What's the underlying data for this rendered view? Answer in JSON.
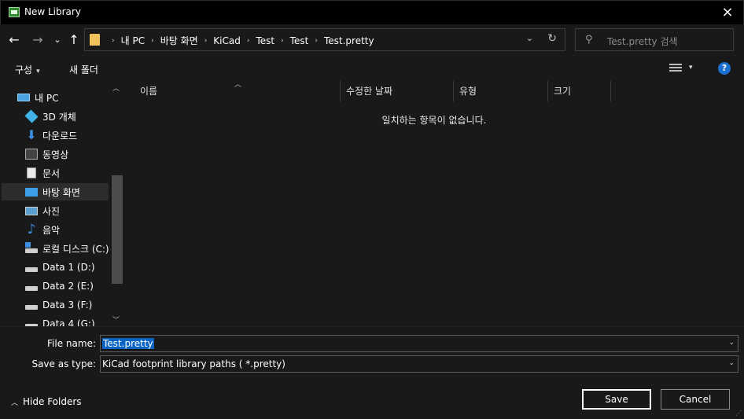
{
  "window": {
    "title": "New Library",
    "close_icon": "×"
  },
  "nav": {
    "back": "←",
    "forward": "→",
    "recent": "⌄",
    "up": "↑"
  },
  "address": {
    "crumbs": [
      "내 PC",
      "바탕 화면",
      "KiCad",
      "Test",
      "Test",
      "Test.pretty"
    ],
    "separator": "›",
    "dropdown": "⌄",
    "refresh": "↻"
  },
  "search": {
    "placeholder": "Test.pretty 검색",
    "icon": "⚲"
  },
  "toolbar": {
    "organize": "구성",
    "caret": "▾",
    "new_folder": "새 폴더",
    "help": "?"
  },
  "tree": [
    {
      "label": "내 PC",
      "icon": "computer-icon"
    },
    {
      "label": "3D 개체",
      "icon": "3d-objects-icon"
    },
    {
      "label": "다운로드",
      "icon": "download-icon"
    },
    {
      "label": "동영상",
      "icon": "video-icon"
    },
    {
      "label": "문서",
      "icon": "document-icon"
    },
    {
      "label": "바탕 화면",
      "icon": "desktop-icon",
      "selected": true
    },
    {
      "label": "사진",
      "icon": "pictures-icon"
    },
    {
      "label": "음악",
      "icon": "music-icon"
    },
    {
      "label": "로컬 디스크 (C:)",
      "icon": "system-drive-icon"
    },
    {
      "label": "Data 1 (D:)",
      "icon": "drive-icon"
    },
    {
      "label": "Data 2 (E:)",
      "icon": "drive-icon"
    },
    {
      "label": "Data 3 (F:)",
      "icon": "drive-icon"
    },
    {
      "label": "Data 4 (G:)",
      "icon": "drive-icon"
    }
  ],
  "columns": [
    "이름",
    "수정한 날짜",
    "유형",
    "크기"
  ],
  "empty_message": "일치하는 항목이 없습니다.",
  "form": {
    "file_name_label": "File name:",
    "file_name_value": "Test.pretty",
    "save_type_label": "Save as type:",
    "save_type_value": "KiCad footprint library paths ( *.pretty)",
    "caret": "⌄"
  },
  "footer": {
    "hide_folders": "Hide Folders",
    "chev": "︿",
    "save": "Save",
    "cancel": "Cancel",
    "grip": "⋰"
  },
  "colors": {
    "accent": "#0a64c4",
    "folder": "#f1c15b",
    "help": "#1a6fd1"
  }
}
